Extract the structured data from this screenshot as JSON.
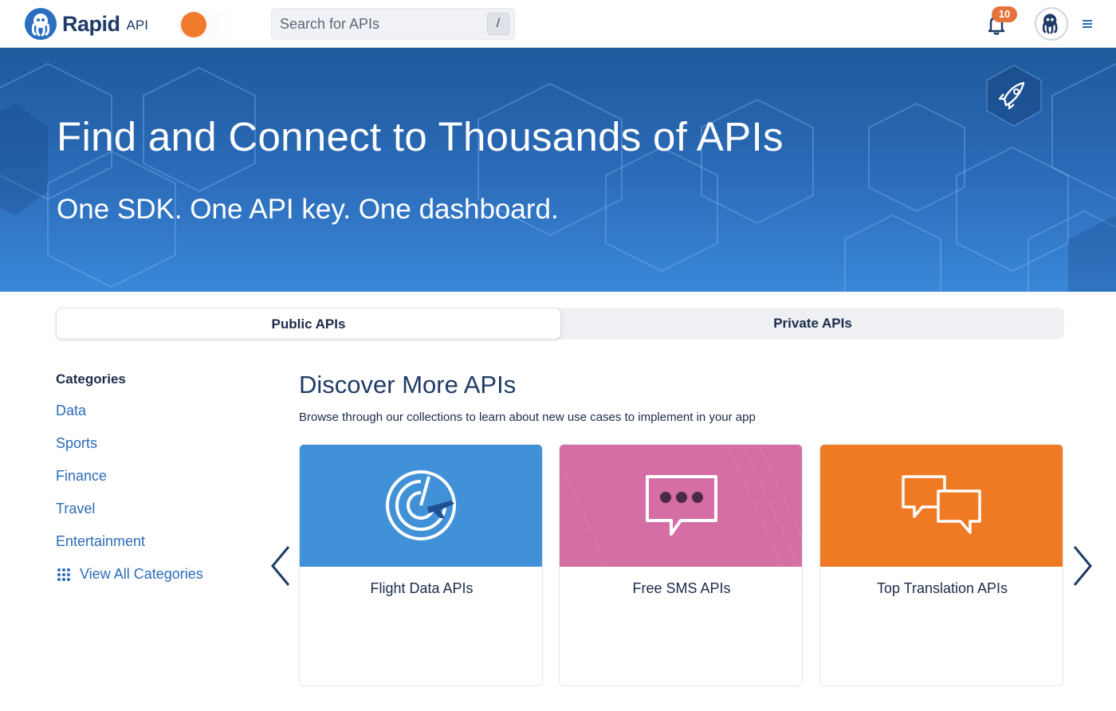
{
  "header": {
    "logo_text": "Rapid",
    "logo_sub": "API",
    "search_placeholder": "Search for APIs",
    "search_shortcut": "/",
    "notification_count": "10",
    "menu_icon": "hamburger-icon",
    "colors": {
      "brand": "#1f3b66",
      "accent": "#f07b2c",
      "link": "#2b6cb8"
    }
  },
  "hero": {
    "title": "Find and Connect to Thousands of APIs",
    "subtitle": "One SDK. One API key. One dashboard.",
    "icon": "rocket-icon"
  },
  "tabs": [
    {
      "label": "Public APIs",
      "active": true
    },
    {
      "label": "Private APIs",
      "active": false
    }
  ],
  "sidebar": {
    "title": "Categories",
    "items": [
      "Data",
      "Sports",
      "Finance",
      "Travel",
      "Entertainment"
    ],
    "view_all": "View All Categories"
  },
  "discover": {
    "title": "Discover More APIs",
    "subtitle": "Browse through our collections to learn about new use cases to implement in your app",
    "cards": [
      {
        "label": "Flight Data APIs",
        "color": "#4191d8",
        "icon": "radar-plane-icon"
      },
      {
        "label": "Free SMS APIs",
        "color": "#d46ea4",
        "icon": "chat-bubble-icon"
      },
      {
        "label": "Top Translation APIs",
        "color": "#f07a24",
        "icon": "translation-bubbles-icon"
      }
    ]
  }
}
